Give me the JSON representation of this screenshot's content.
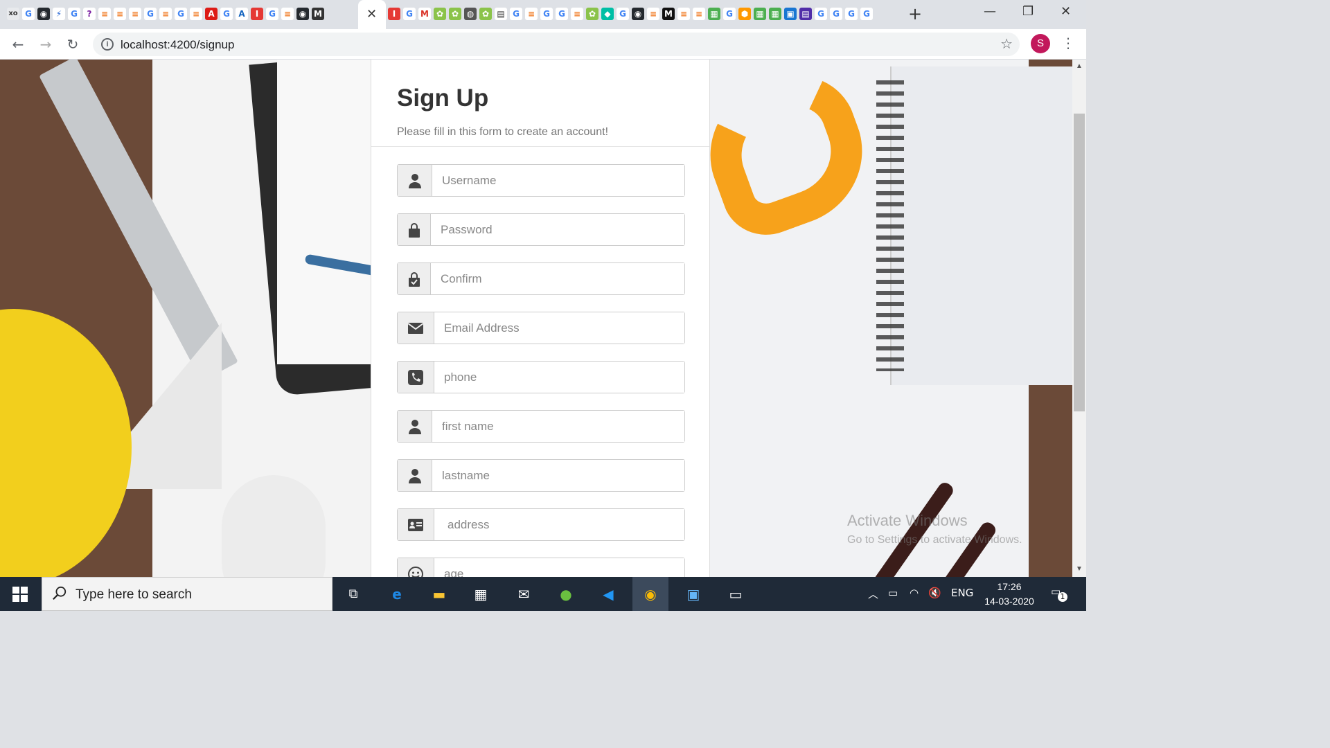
{
  "browser": {
    "url": "localhost:4200/signup",
    "profile_initial": "S",
    "new_tab_label": "+",
    "close_tab_label": "✕"
  },
  "form": {
    "title": "Sign Up",
    "subtitle": "Please fill in this form to create an account!",
    "fields": [
      {
        "icon": "user-icon",
        "placeholder": "Username"
      },
      {
        "icon": "lock-icon",
        "placeholder": "Password"
      },
      {
        "icon": "lock-check-icon",
        "placeholder": "Confirm"
      },
      {
        "icon": "envelope-icon",
        "placeholder": "Email Address"
      },
      {
        "icon": "phone-icon",
        "placeholder": "phone"
      },
      {
        "icon": "user-icon",
        "placeholder": "first name"
      },
      {
        "icon": "user-icon",
        "placeholder": "lastname"
      },
      {
        "icon": "address-card-icon",
        "placeholder": "address"
      },
      {
        "icon": "smile-icon",
        "placeholder": "age"
      }
    ]
  },
  "watermark": {
    "title": "Activate Windows",
    "subtitle": "Go to Settings to activate Windows."
  },
  "taskbar": {
    "search_placeholder": "Type here to search",
    "language": "ENG",
    "time": "17:26",
    "date": "14-03-2020",
    "notification_count": "1"
  },
  "colors": {
    "profile_avatar": "#c2185b",
    "taskbar": "#1f2a38",
    "card_title": "#333333"
  }
}
